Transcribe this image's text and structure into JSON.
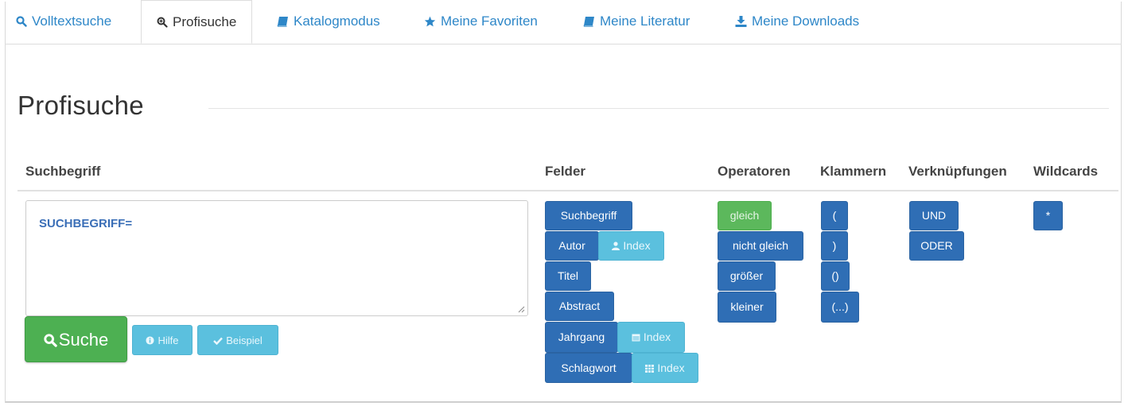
{
  "tabs": [
    {
      "label": "Volltextsuche",
      "icon": "search-icon"
    },
    {
      "label": "Profisuche",
      "icon": "zoom-search-icon",
      "active": true
    },
    {
      "label": "Katalogmodus",
      "icon": "book-icon"
    },
    {
      "label": "Meine Favoriten",
      "icon": "star-icon"
    },
    {
      "label": "Meine Literatur",
      "icon": "book-icon"
    },
    {
      "label": "Meine Downloads",
      "icon": "download-icon"
    }
  ],
  "page": {
    "title": "Profisuche"
  },
  "columns": {
    "suchbegriff": "Suchbegriff",
    "felder": "Felder",
    "operatoren": "Operatoren",
    "klammern": "Klammern",
    "verknuepfungen": "Verknüpfungen",
    "wildcards": "Wildcards"
  },
  "query": {
    "value": "SUCHBEGRIFF="
  },
  "actions": {
    "search": "Suche",
    "help": "Hilfe",
    "example": "Beispiel"
  },
  "fields": {
    "suchbegriff": "Suchbegriff",
    "autor": "Autor",
    "autor_index": "Index",
    "titel": "Titel",
    "abstract": "Abstract",
    "jahrgang": "Jahrgang",
    "jahrgang_index": "Index",
    "schlagwort": "Schlagwort",
    "schlagwort_index": "Index"
  },
  "operators": [
    "gleich",
    "nicht gleich",
    "größer",
    "kleiner"
  ],
  "brackets": [
    "(",
    ")",
    "()",
    "(...)"
  ],
  "connectors": [
    "UND",
    "ODER"
  ],
  "wildcards": [
    "*"
  ],
  "colors": {
    "link": "#2e87c8",
    "primary": "#2f6eb5",
    "info": "#5bc0de",
    "success": "#5cb85c"
  }
}
